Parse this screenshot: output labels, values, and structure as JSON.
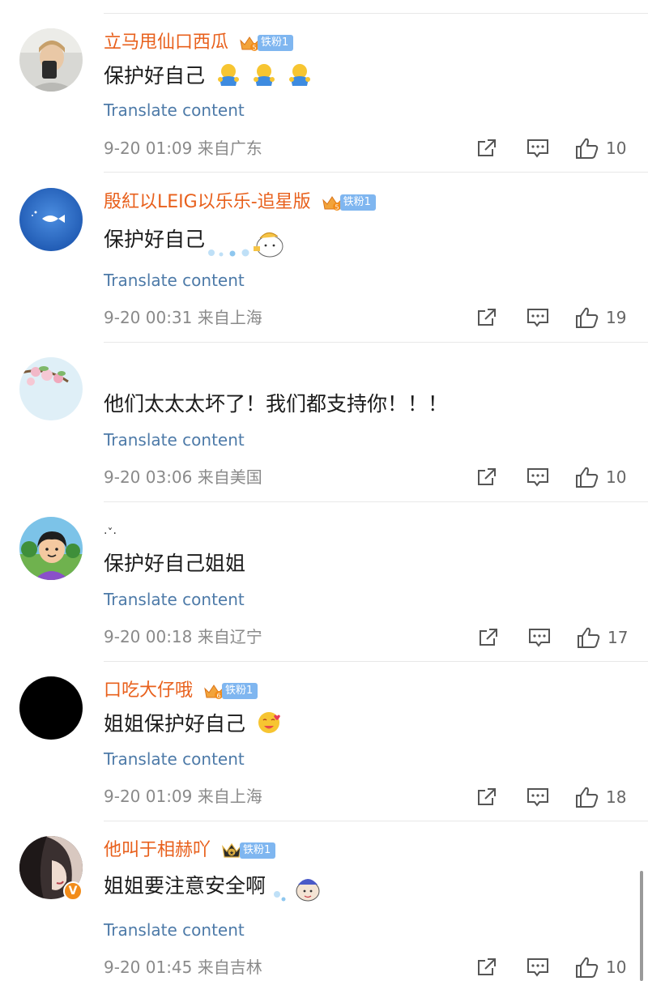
{
  "colors": {
    "username": "#e8601c",
    "translate_link": "#4d7aa8",
    "meta_text": "#8a8a8a",
    "fan_badge": "#7fb6f0",
    "divider": "#e8e8e8"
  },
  "comments": [
    {
      "username": "立马甩仙口西瓜",
      "crown_level": "5",
      "fan_badge": "铁粉1",
      "text": "保护好自己",
      "emojis": [
        "hug-emoji",
        "hug-emoji",
        "hug-emoji"
      ],
      "translate": "Translate content",
      "time": "9-20 01:09",
      "location": "来自广东",
      "likes": "10"
    },
    {
      "username": "殷紅以LEIG以乐乐-追星版",
      "crown_level": "5",
      "fan_badge": "铁粉1",
      "text": "保护好自己",
      "emojis": [
        "bubble-sticker"
      ],
      "translate": "Translate content",
      "time": "9-20 00:31",
      "location": "来自上海",
      "likes": "19"
    },
    {
      "username": "",
      "crown_level": "",
      "fan_badge": "",
      "text": "他们太太太坏了！我们都支持你！！！",
      "emojis": [],
      "translate": "Translate content",
      "time": "9-20 03:06",
      "location": "来自美国",
      "likes": "10"
    },
    {
      "username": "·ˇ·",
      "crown_level": "",
      "fan_badge": "",
      "text": "保护好自己姐姐",
      "emojis": [],
      "translate": "Translate content",
      "time": "9-20 00:18",
      "location": "来自辽宁",
      "likes": "17"
    },
    {
      "username": "口吃大仔哦",
      "crown_level": "6",
      "fan_badge": "铁粉1",
      "text": "姐姐保护好自己",
      "emojis": [
        "love-kiss-emoji"
      ],
      "translate": "Translate content",
      "time": "9-20 01:09",
      "location": "来自上海",
      "likes": "18"
    },
    {
      "username": "他叫于相赫吖",
      "crown_level": "★",
      "fan_badge": "铁粉1",
      "text": "姐姐要注意安全啊",
      "emojis": [
        "cartoon-sticker"
      ],
      "translate": "Translate content",
      "time": "9-20 01:45",
      "location": "来自吉林",
      "likes": "10"
    }
  ]
}
